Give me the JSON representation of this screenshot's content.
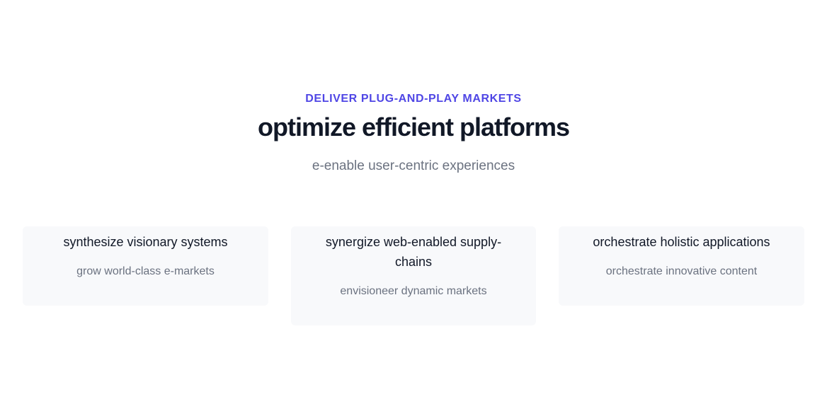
{
  "hero": {
    "eyebrow": "Deliver plug-and-play markets",
    "title": "optimize efficient platforms",
    "subtitle": "e-enable user-centric experiences"
  },
  "features": [
    {
      "title": "synthesize visionary systems",
      "description": "grow world-class e-markets"
    },
    {
      "title": "synergize web-enabled supply-chains",
      "description": "envisioneer dynamic markets"
    },
    {
      "title": "orchestrate holistic applications",
      "description": "orchestrate innovative content"
    }
  ],
  "colors": {
    "accent": "#4f46e5",
    "heading": "#111827",
    "muted": "#6b7280",
    "card_background": "#f8f9fb"
  }
}
